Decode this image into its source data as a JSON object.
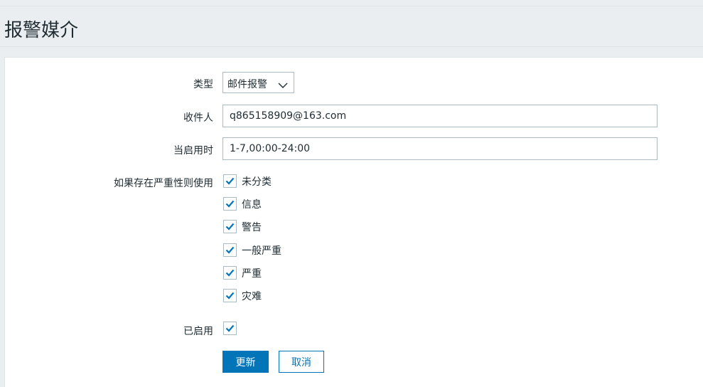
{
  "page": {
    "title": "报警媒介"
  },
  "form": {
    "type": {
      "label": "类型",
      "value": "邮件报警"
    },
    "sendto": {
      "label": "收件人",
      "value": "q865158909@163.com"
    },
    "period": {
      "label": "当启用时",
      "value": "1-7,00:00-24:00"
    },
    "severity": {
      "label": "如果存在严重性则使用",
      "options": [
        {
          "label": "未分类",
          "checked": true
        },
        {
          "label": "信息",
          "checked": true
        },
        {
          "label": "警告",
          "checked": true
        },
        {
          "label": "一般严重",
          "checked": true
        },
        {
          "label": "严重",
          "checked": true
        },
        {
          "label": "灾难",
          "checked": true
        }
      ]
    },
    "enabled": {
      "label": "已启用",
      "checked": true
    }
  },
  "buttons": {
    "update": "更新",
    "cancel": "取消"
  },
  "colors": {
    "accent": "#0275b8",
    "border": "#acbbc2",
    "background": "#ebeef0"
  },
  "icons": {
    "dropdown": "chevron-down-icon",
    "check": "check-icon"
  }
}
